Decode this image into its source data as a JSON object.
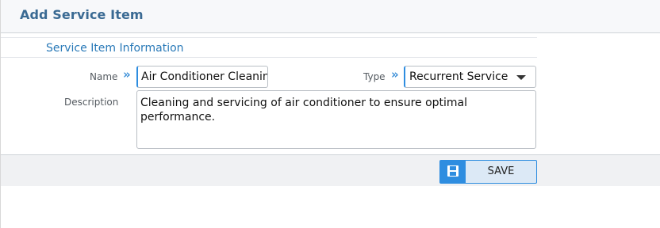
{
  "page": {
    "title": "Add Service Item"
  },
  "section": {
    "title": "Service Item Information"
  },
  "form": {
    "name_label": "Name",
    "name_value": "Air Conditioner Cleaning",
    "type_label": "Type",
    "type_value": "Recurrent Service",
    "description_label": "Description",
    "description_value": "Cleaning and servicing of air conditioner to ensure optimal performance."
  },
  "actions": {
    "save_label": "SAVE"
  },
  "icons": {
    "required": "double-chevron-right-icon",
    "save": "floppy-disk-icon",
    "dropdown": "caret-down-icon"
  },
  "colors": {
    "accent": "#2e8de0",
    "title": "#3a6a93",
    "section_title": "#2a7ab8"
  }
}
